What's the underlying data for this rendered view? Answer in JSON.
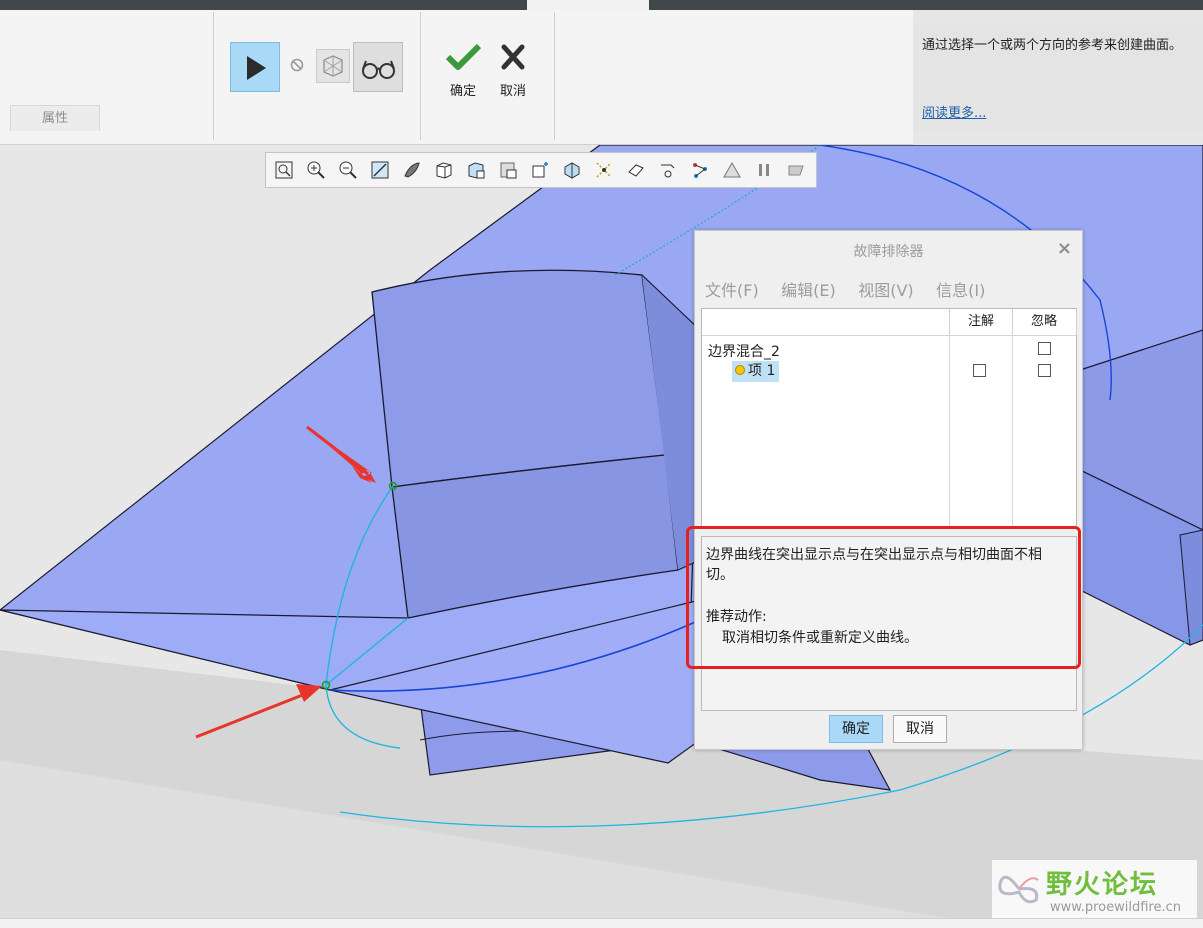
{
  "ribbon": {
    "properties_tab": "属性",
    "ok_label": "确定",
    "cancel_label": "取消"
  },
  "help": {
    "text": "通过选择一个或两个方向的参考来创建曲面。",
    "link": "阅读更多..."
  },
  "view_toolbar": {
    "icons": [
      "zoom-fit-icon",
      "zoom-in-icon",
      "zoom-out-icon",
      "repaint-icon",
      "display-style-icon",
      "saved-views-icon",
      "view-manager-icon",
      "section-icon",
      "datum-display-icon",
      "spin-center-icon",
      "annotation-display-icon",
      "appearance-icon",
      "measure-icon",
      "model-tree-icon",
      "pause-icon",
      "perspective-icon"
    ]
  },
  "dialog": {
    "title": "故障排除器",
    "menu": [
      "文件(F)",
      "编辑(E)",
      "视图(V)",
      "信息(I)"
    ],
    "columns": {
      "note": "注解",
      "ignore": "忽略"
    },
    "tree": {
      "root": "边界混合_2",
      "child": "项 1"
    },
    "message": {
      "line1": "边界曲线在突出显示点与在突出显示点与相切曲面不相切。",
      "action_title": "推荐动作:",
      "action": "取消相切条件或重新定义曲线。"
    },
    "ok": "确定",
    "cancel": "取消"
  },
  "watermark": {
    "title": "野火论坛",
    "url": "www.proewildfire.cn"
  },
  "colors": {
    "surface": "#9aa8f4",
    "accent": "#a9d9f6",
    "highlight": "#e3221f",
    "curve": "#1fa9d6",
    "arrow": "#e8342a"
  }
}
